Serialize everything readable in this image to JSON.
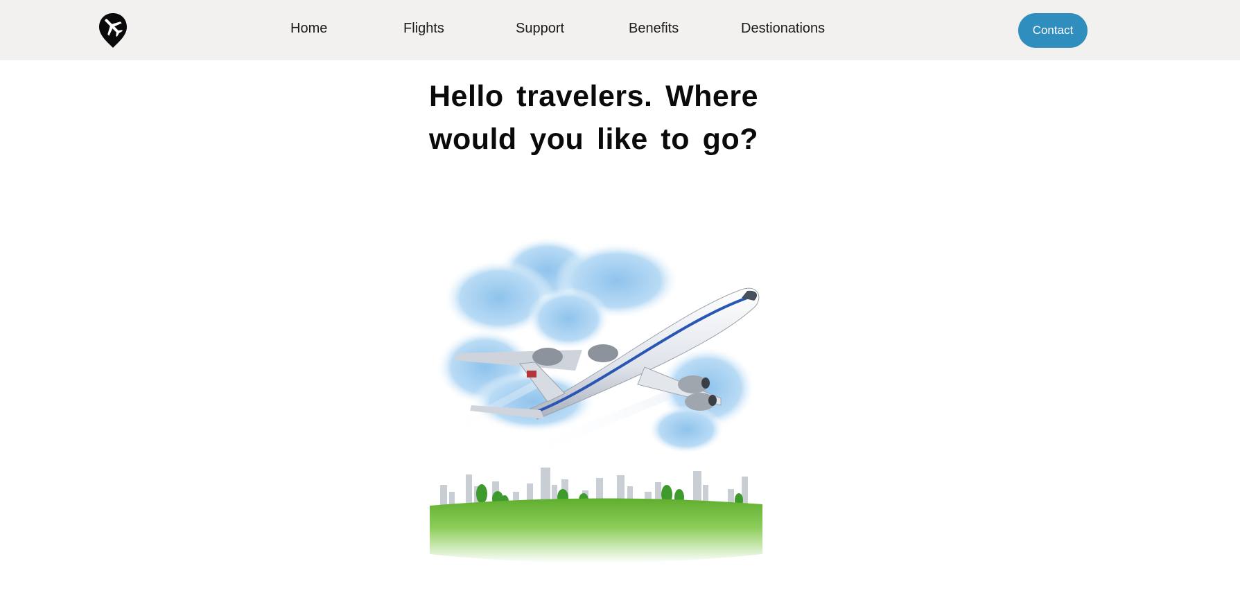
{
  "header": {
    "logo_icon": "plane-location-pin-icon",
    "nav": [
      {
        "label": "Home"
      },
      {
        "label": "Flights"
      },
      {
        "label": "Support"
      },
      {
        "label": "Benefits"
      },
      {
        "label": "Destionations"
      }
    ],
    "contact_label": "Contact"
  },
  "hero": {
    "title": "Hello travelers. Where would you like to go?",
    "image_icon": "airplane-over-city-illustration"
  },
  "colors": {
    "navbar_bg": "#f2f1ef",
    "accent": "#2f8ebd",
    "text": "#1a1a1a"
  }
}
